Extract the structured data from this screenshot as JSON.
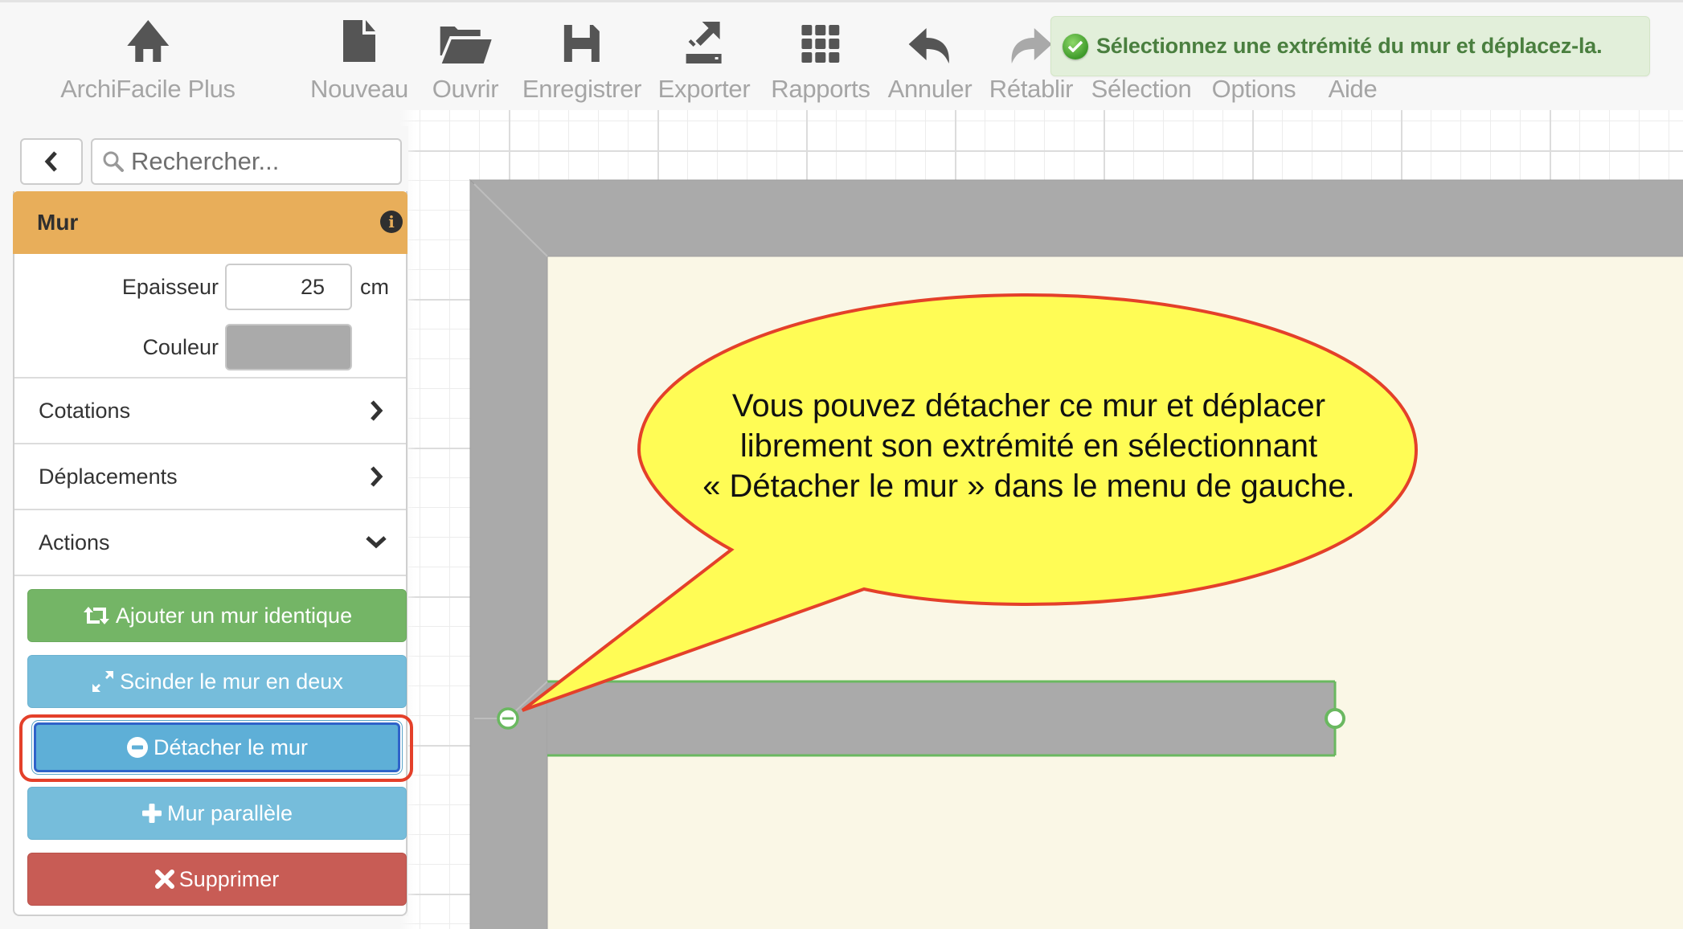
{
  "toolbar": {
    "items": [
      {
        "label": "ArchiFacile Plus",
        "icon": "home-icon",
        "enabled": true
      },
      {
        "label": "Nouveau",
        "icon": "new-file-icon",
        "enabled": true
      },
      {
        "label": "Ouvrir",
        "icon": "folder-open-icon",
        "enabled": true
      },
      {
        "label": "Enregistrer",
        "icon": "save-icon",
        "enabled": true
      },
      {
        "label": "Exporter",
        "icon": "export-icon",
        "enabled": true
      },
      {
        "label": "Rapports",
        "icon": "grid-icon",
        "enabled": true
      },
      {
        "label": "Annuler",
        "icon": "undo-icon",
        "enabled": true
      },
      {
        "label": "Rétablir",
        "icon": "redo-icon",
        "enabled": false
      },
      {
        "label": "Sélection",
        "icon": "selection-icon",
        "enabled": true
      },
      {
        "label": "Options",
        "icon": "options-icon",
        "enabled": true
      },
      {
        "label": "Aide",
        "icon": "help-icon",
        "enabled": true
      }
    ]
  },
  "notification": {
    "type": "success",
    "icon": "check-circle-icon",
    "message": "Sélectionnez une extrémité du mur et déplacez-la."
  },
  "sidebar": {
    "back_icon": "chevron-left-icon",
    "search": {
      "placeholder": "Rechercher...",
      "value": ""
    },
    "panel": {
      "title": "Mur",
      "info_icon": "info-icon",
      "thickness": {
        "label": "Epaisseur",
        "value": "25",
        "unit": "cm"
      },
      "color": {
        "label": "Couleur",
        "value": "#aaaaaa"
      },
      "sections": [
        {
          "label": "Cotations",
          "expanded": false
        },
        {
          "label": "Déplacements",
          "expanded": false
        },
        {
          "label": "Actions",
          "expanded": true
        }
      ],
      "actions": [
        {
          "label": "Ajouter un mur identique",
          "icon": "retweet-icon",
          "style": "success"
        },
        {
          "label": "Scinder le mur en deux",
          "icon": "resize-icon",
          "style": "info"
        },
        {
          "label": "Détacher le mur",
          "icon": "minus-circle-icon",
          "style": "primary",
          "highlighted": true
        },
        {
          "label": "Mur parallèle",
          "icon": "plus-icon",
          "style": "info"
        },
        {
          "label": "Supprimer",
          "icon": "times-icon",
          "style": "danger"
        }
      ]
    }
  },
  "canvas": {
    "wall_color": "#aaaaaa",
    "room_fill": "#faf7e6",
    "selection_color": "#6ab860",
    "callout": {
      "lines": [
        "Vous pouvez détacher ce mur et déplacer",
        "librement son extrémité en sélectionnant",
        "« Détacher le mur » dans le menu de gauche."
      ],
      "fill": "#fffc55",
      "stroke": "#e4402a"
    }
  }
}
